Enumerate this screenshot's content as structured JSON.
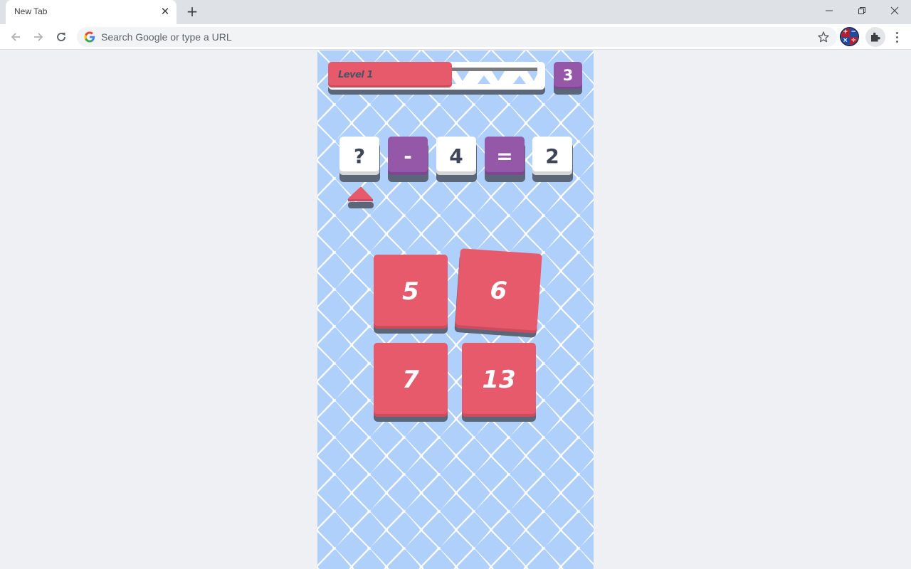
{
  "browser": {
    "tab_title": "New Tab",
    "tab_close_glyph": "✕",
    "new_tab_glyph": "+",
    "omnibox_placeholder": "Search Google or type a URL",
    "extension_math_symbols": [
      "+",
      "−",
      "×",
      "÷"
    ]
  },
  "game": {
    "level_label": "Level 1",
    "level_progress": 0.57,
    "moves_left": "3",
    "equation": [
      {
        "value": "?",
        "type": "unknown"
      },
      {
        "value": "-",
        "type": "operator"
      },
      {
        "value": "4",
        "type": "number"
      },
      {
        "value": "=",
        "type": "operator"
      },
      {
        "value": "2",
        "type": "number"
      }
    ],
    "selected_slot": 0,
    "cards": [
      {
        "value": "5"
      },
      {
        "value": "6"
      },
      {
        "value": "7"
      },
      {
        "value": "13"
      }
    ],
    "colors": {
      "card_red": "#e65a6b",
      "operator_purple": "#9558a8",
      "pattern_blue": "#b0d0fc",
      "text_dark": "#3f4659"
    }
  }
}
